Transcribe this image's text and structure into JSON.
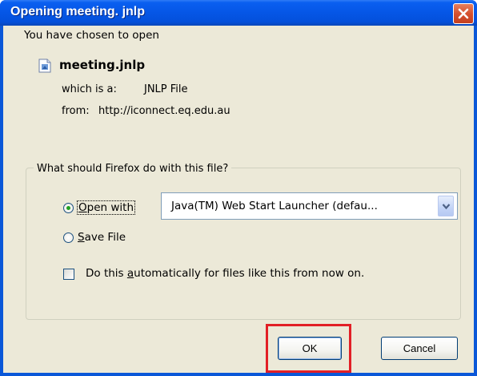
{
  "window": {
    "title": "Opening meeting. jnlp"
  },
  "dialog": {
    "heading": "You have chosen to open",
    "file_name": "meeting.jnlp",
    "type_label": "which is a:",
    "type_value": "JNLP File",
    "from_label": "from:",
    "from_value": "http://iconnect.eq.edu.au"
  },
  "group": {
    "legend": "What should Firefox do with this file?",
    "open_with": {
      "prefix": "",
      "mnemonic": "O",
      "rest": "pen with",
      "selected": true
    },
    "application": "Java(TM) Web Start Launcher (defau...",
    "save_file": {
      "mnemonic": "S",
      "rest": "ave File",
      "selected": false
    },
    "auto": {
      "prefix": "Do this ",
      "mnemonic": "a",
      "rest": "utomatically for files like this from now on.",
      "checked": false
    }
  },
  "buttons": {
    "ok": "OK",
    "cancel": "Cancel"
  },
  "colors": {
    "titlebar": "#0556e6",
    "dialog_bg": "#ece9d8",
    "highlight_box": "#e21f26",
    "radio_selected": "#21a121"
  },
  "icons": {
    "close": "close-icon",
    "file": "file-icon",
    "dropdown": "chevron-down-icon"
  }
}
